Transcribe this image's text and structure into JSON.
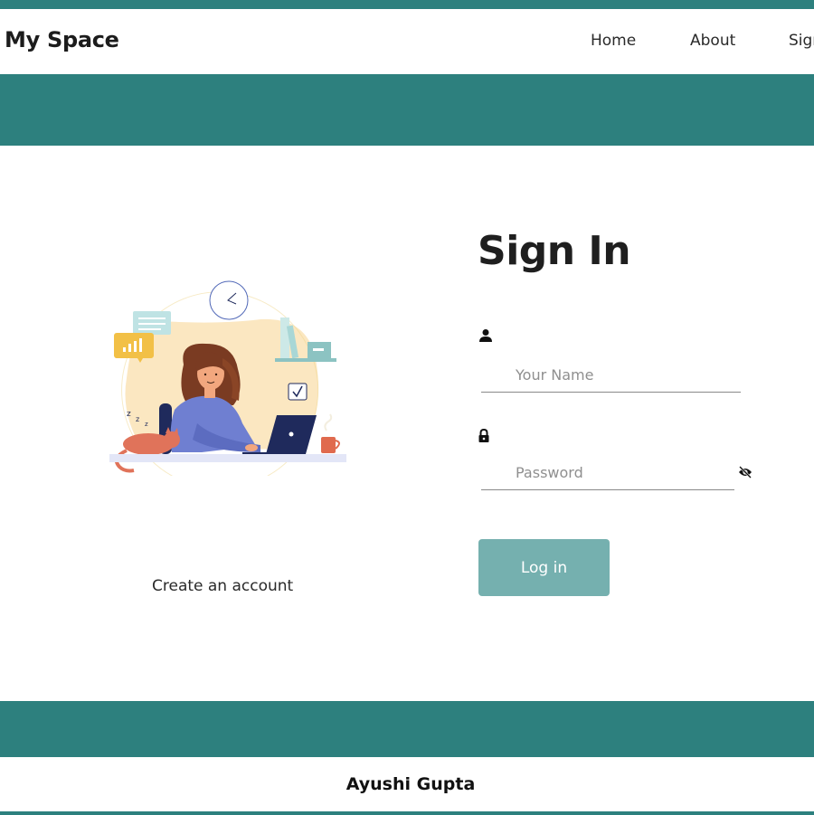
{
  "header": {
    "brand": "My Space",
    "nav": [
      "Home",
      "About",
      "Sign"
    ]
  },
  "illustration": {
    "name": "woman-working-on-laptop-illustration"
  },
  "create_account_link": "Create an account",
  "signin": {
    "title": "Sign In",
    "name_placeholder": "Your Name",
    "password_placeholder": "Password",
    "login_label": "Log in",
    "icons": {
      "name_field": "user-icon",
      "password_field": "lock-icon",
      "toggle_visibility": "eye-off-icon"
    }
  },
  "footer": {
    "author": "Ayushi Gupta"
  },
  "colors": {
    "accent": "#2d807e",
    "button": "#75b0af"
  }
}
